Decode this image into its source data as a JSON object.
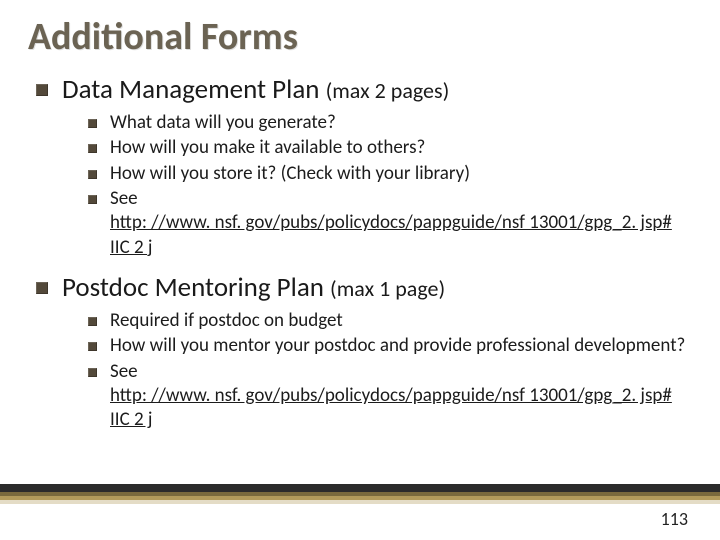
{
  "title": "Additional Forms",
  "sections": [
    {
      "heading": "Data Management Plan",
      "note": "(max 2 pages)",
      "items": [
        {
          "text": "What data will you generate?"
        },
        {
          "text": "How will you make it available to others?"
        },
        {
          "text": "How will you store it? (Check with your library)"
        },
        {
          "text": "See",
          "link_lines": [
            "http: //www. nsf. gov/pubs/policydocs/pappguide/nsf 13001/gpg_2. jsp#",
            "IIC 2 j"
          ]
        }
      ]
    },
    {
      "heading": "Postdoc Mentoring Plan",
      "note": "(max 1 page)",
      "items": [
        {
          "text": "Required if postdoc on budget"
        },
        {
          "text": "How will you mentor your postdoc and provide professional development?"
        },
        {
          "text": "See",
          "link_lines": [
            "http: //www. nsf. gov/pubs/policydocs/pappguide/nsf 13001/gpg_2. jsp#",
            "IIC 2 j"
          ]
        }
      ]
    }
  ],
  "page_number": "113"
}
